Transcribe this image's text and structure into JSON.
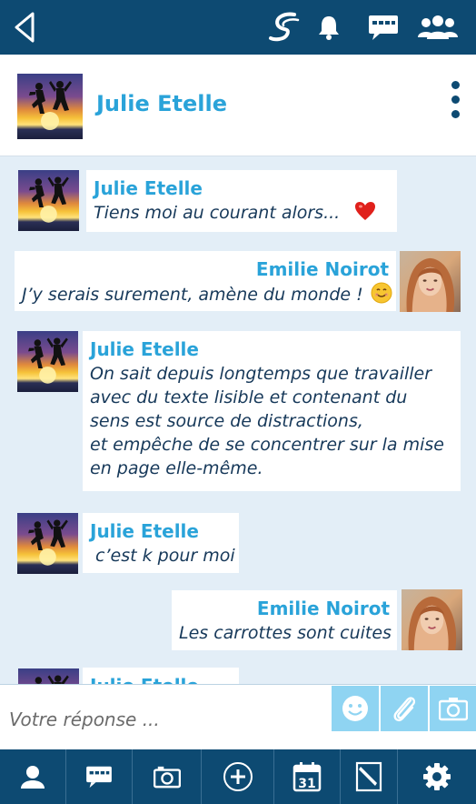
{
  "topbar": {
    "icons": [
      "back-icon",
      "brand-logo-icon",
      "bell-icon",
      "chat-icon",
      "group-icon"
    ]
  },
  "contact": {
    "name": "Julie Etelle",
    "more_icon": "more-vertical-icon"
  },
  "messages": [
    {
      "author": "Julie Etelle",
      "side": "left",
      "lines": [
        "Tiens moi au courant alors..."
      ],
      "emoji": "heart-icon"
    },
    {
      "author": "Emilie Noirot",
      "side": "right",
      "lines": [
        "J’y serais surement, amène du monde !"
      ],
      "emoji": "smile-emoji-icon"
    },
    {
      "author": "Julie Etelle",
      "side": "left",
      "lines": [
        "On sait depuis longtemps que travailler",
        "avec du texte lisible et contenant du",
        "sens est source de distractions,",
        "et empêche de se concentrer sur la mise",
        "en page elle-même."
      ]
    },
    {
      "author": "Julie Etelle",
      "side": "left",
      "lines": [
        " c’est k pour moi"
      ]
    },
    {
      "author": "Emilie Noirot",
      "side": "right",
      "lines": [
        "Les carrottes sont cuites"
      ]
    },
    {
      "author": "Julie Etelle",
      "side": "left",
      "lines": [
        ""
      ]
    }
  ],
  "composer": {
    "placeholder": "Votre réponse ...",
    "buttons": [
      "smiley-icon",
      "paperclip-icon",
      "camera-icon"
    ]
  },
  "bottomnav": {
    "items": [
      "profile-icon",
      "messages-icon",
      "camera-icon",
      "add-icon",
      "calendar-icon",
      "notes-icon",
      "settings-icon"
    ],
    "calendar_day": "31"
  },
  "colors": {
    "primary": "#0d4a72",
    "accent": "#2aa3d9",
    "text": "#17395a",
    "background": "#e3eef7",
    "composer_button": "#8fd4f2",
    "heart": "#e0201b"
  }
}
